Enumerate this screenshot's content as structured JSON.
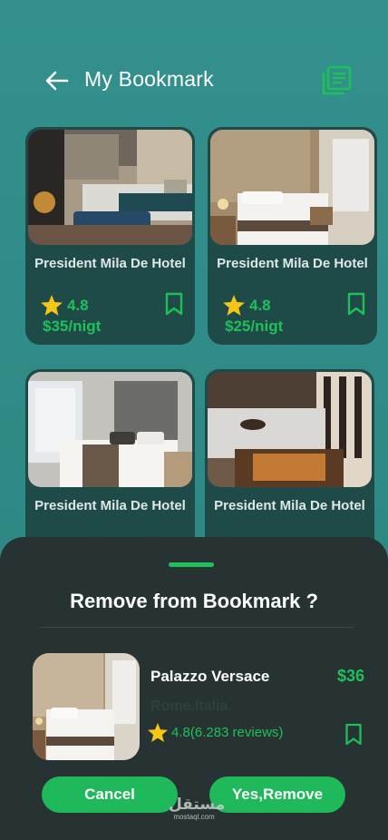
{
  "header": {
    "title": "My Bookmark",
    "back_icon": "arrow-left-icon",
    "list_icon": "document-list-icon"
  },
  "cards": [
    {
      "name": "President Mila De Hotel",
      "rating": "4.8",
      "price": "$35/nigt"
    },
    {
      "name": "President Mila De Hotel",
      "rating": "4.8",
      "price": "$25/nigt"
    },
    {
      "name": "President Mila De Hotel"
    },
    {
      "name": "President Mila De Hotel"
    }
  ],
  "sheet": {
    "title": "Remove from Bookmark ?",
    "item": {
      "name": "Palazzo Versace",
      "price": "$36",
      "location": "Rome,Italia",
      "rating": "4.8(6.283 reviews)"
    },
    "cancel_label": "Cancel",
    "remove_label": "Yes,Remove"
  },
  "watermark": {
    "arabic": "مستقل",
    "latin": "mostaql.com"
  },
  "colors": {
    "background": "#2f8a87",
    "card": "#1e4a48",
    "sheet": "#273332",
    "accent": "#1fc05a",
    "star": "#f5c518"
  }
}
